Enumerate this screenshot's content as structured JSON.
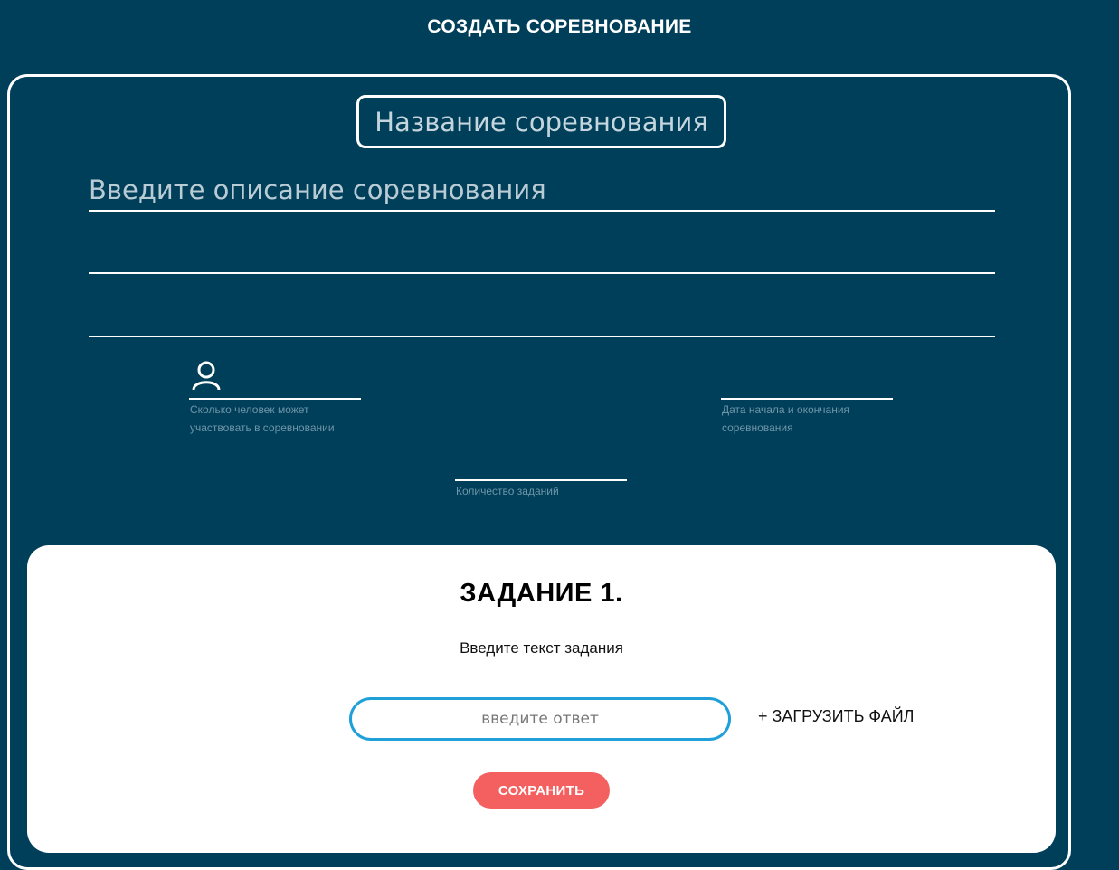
{
  "header": {
    "title": "СОЗДАТЬ СОРЕВНОВАНИЕ"
  },
  "form": {
    "name_placeholder": "Название соревнования",
    "description_placeholder": "Введите описание соревнования",
    "participants": {
      "icon": "person-icon",
      "hint_line1": "Сколько человек может",
      "hint_line2": "участвовать в соревновании"
    },
    "dates": {
      "hint_line1": "Дата начала и окончания",
      "hint_line2": "соревнования"
    },
    "tasks_count": {
      "hint": "Количество заданий"
    }
  },
  "task": {
    "title": "ЗАДАНИЕ 1.",
    "text": "Введите текст задания",
    "answer_placeholder": "введите ответ",
    "upload_label": "+ ЗАГРУЗИТЬ ФАЙЛ",
    "save_label": "СОХРАНИТЬ"
  },
  "colors": {
    "background": "#003f5a",
    "save_button": "#f45f5f",
    "answer_border": "#1fa0d8"
  }
}
